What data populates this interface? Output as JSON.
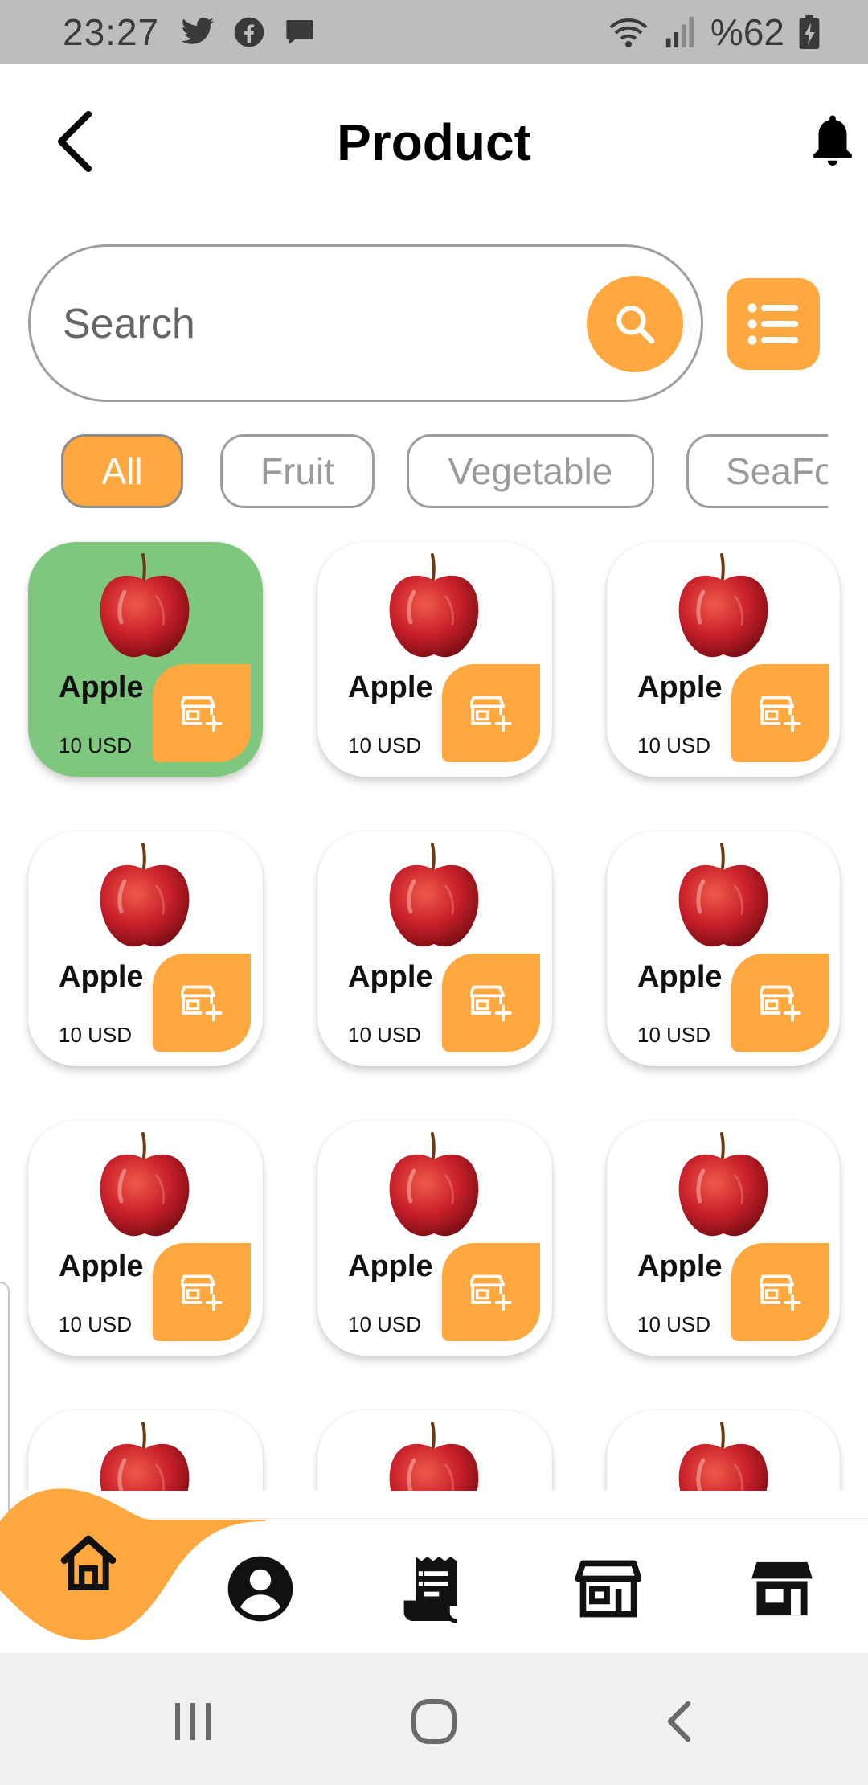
{
  "status_bar": {
    "time": "23:27",
    "battery": "%62",
    "icons": [
      "twitter-icon",
      "facebook-icon",
      "message-icon",
      "wifi-icon",
      "signal-icon",
      "battery-charging-icon"
    ]
  },
  "header": {
    "title": "Product",
    "back_icon": "chevron-left-icon",
    "notification_icon": "bell-icon"
  },
  "search": {
    "placeholder": "Search",
    "value": "",
    "button_icon": "search-icon",
    "filter_icon": "list-icon"
  },
  "categories": {
    "selected": "All",
    "items": [
      {
        "label": "All"
      },
      {
        "label": "Fruit"
      },
      {
        "label": "Vegetable"
      },
      {
        "label": "SeaFo"
      }
    ]
  },
  "products": [
    {
      "name": "Apple",
      "price": "10 USD",
      "selected": true
    },
    {
      "name": "Apple",
      "price": "10 USD"
    },
    {
      "name": "Apple",
      "price": "10 USD"
    },
    {
      "name": "Apple",
      "price": "10 USD"
    },
    {
      "name": "Apple",
      "price": "10 USD"
    },
    {
      "name": "Apple",
      "price": "10 USD"
    },
    {
      "name": "Apple",
      "price": "10 USD"
    },
    {
      "name": "Apple",
      "price": "10 USD"
    },
    {
      "name": "Apple",
      "price": "10 USD"
    },
    {
      "name": "",
      "price": ""
    },
    {
      "name": "",
      "price": ""
    },
    {
      "name": "",
      "price": ""
    }
  ],
  "bottom_nav": {
    "active": "home",
    "items": [
      "home-icon",
      "profile-icon",
      "receipt-icon",
      "store-icon",
      "shop-icon"
    ]
  },
  "colors": {
    "accent": "#ffa83f",
    "selected_card": "#7fc77f",
    "status_bar": "#bdbdbd"
  }
}
